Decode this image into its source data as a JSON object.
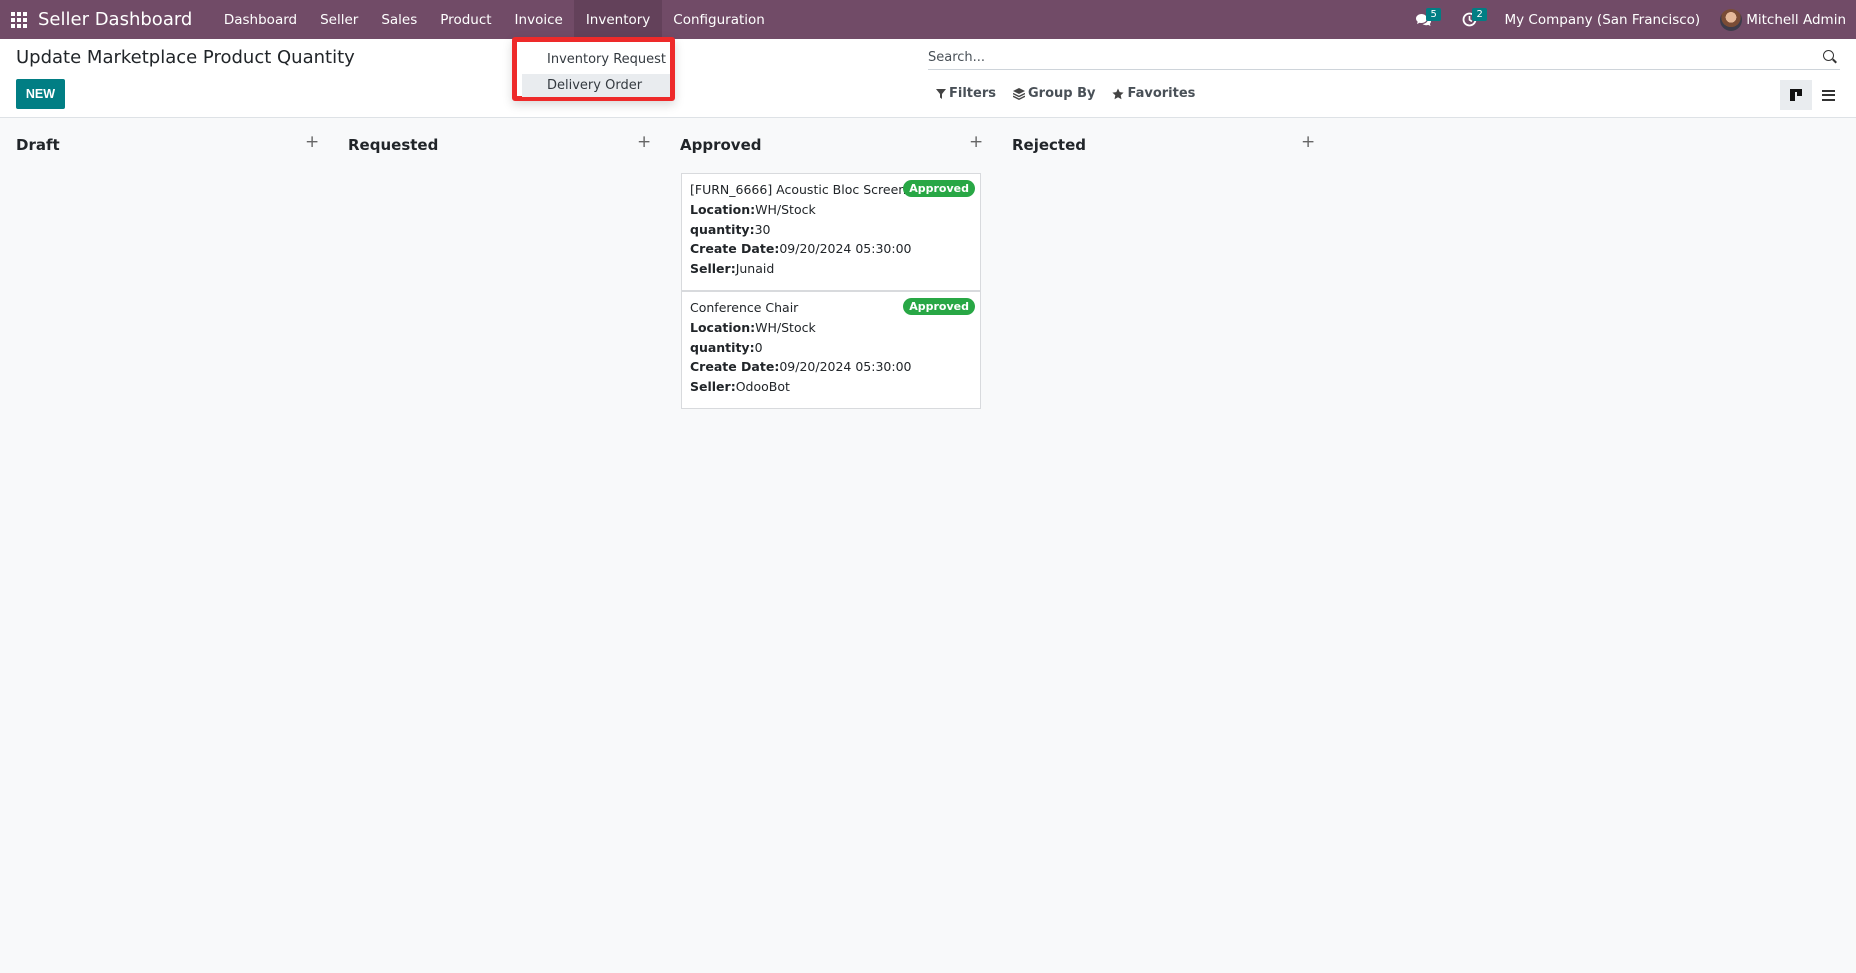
{
  "navbar": {
    "app_title": "Seller Dashboard",
    "menu": [
      "Dashboard",
      "Seller",
      "Sales",
      "Product",
      "Invoice",
      "Inventory",
      "Configuration"
    ],
    "messages_count": "5",
    "activities_count": "2",
    "company": "My Company (San Francisco)",
    "user": "Mitchell Admin"
  },
  "dropdown": {
    "items": [
      "Inventory Request",
      "Delivery Order"
    ]
  },
  "control_panel": {
    "title": "Update Marketplace Product Quantity",
    "new_label": "NEW",
    "search_placeholder": "Search...",
    "filters_label": "Filters",
    "group_by_label": "Group By",
    "favorites_label": "Favorites"
  },
  "kanban": {
    "columns": [
      "Draft",
      "Requested",
      "Approved",
      "Rejected"
    ],
    "field_labels": {
      "location": "Location:",
      "quantity": "quantity:",
      "create_date": "Create Date:",
      "seller": "Seller:"
    },
    "cards": [
      {
        "title": "[FURN_6666] Acoustic Bloc Screens",
        "status": "Approved",
        "location": "WH/Stock",
        "quantity": "30",
        "create_date": "09/20/2024 05:30:00",
        "seller": "Junaid"
      },
      {
        "title": "Conference Chair",
        "status": "Approved",
        "location": "WH/Stock",
        "quantity": "0",
        "create_date": "09/20/2024 05:30:00",
        "seller": "OdooBot"
      }
    ]
  },
  "colors": {
    "navbar": "#714b67",
    "primary_button": "#017e84",
    "approved_badge": "#28a745",
    "highlight_box": "#ee2a2a"
  }
}
